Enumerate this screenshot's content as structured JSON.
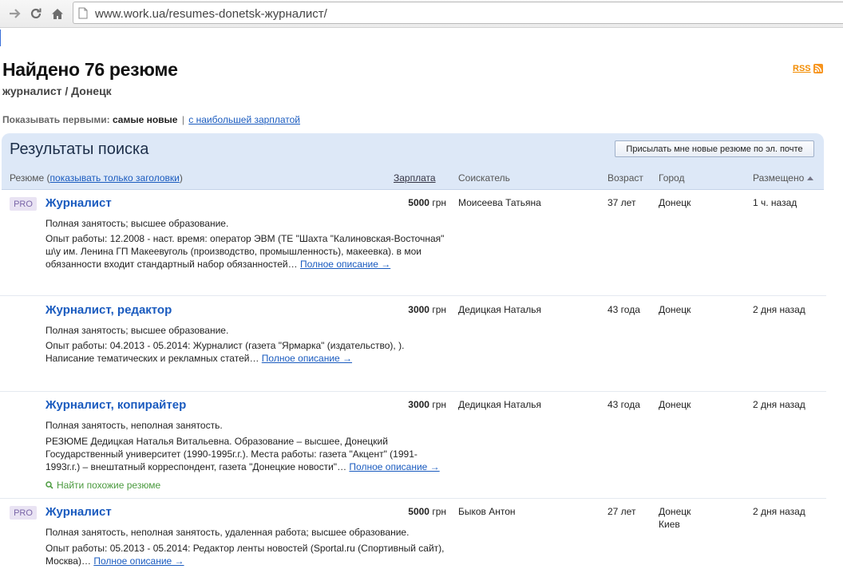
{
  "browser": {
    "url": "www.work.ua/resumes-donetsk-журналист/"
  },
  "page": {
    "title": "Найдено 76 резюме",
    "subtitle": "журналист / Донецк",
    "rss": "RSS",
    "sort": {
      "label": "Показывать первыми:",
      "active": "самые новые",
      "separator": "|",
      "alt": "с наибольшей зарплатой"
    }
  },
  "panel": {
    "title": "Результаты поиска",
    "subscribe_button": "Присылать мне новые резюме по эл. почте",
    "columns": {
      "resume_prefix": "Резюме (",
      "resume_link": "показывать только заголовки",
      "resume_suffix": ")",
      "salary": "Зарплата",
      "seeker": "Соискатель",
      "age": "Возраст",
      "city": "Город",
      "posted": "Размещено"
    }
  },
  "results": [
    {
      "pro": "PRO",
      "title": "Журналист",
      "salary_amount": "5000",
      "salary_currency": "грн",
      "name": "Моисеева Татьяна",
      "age": "37 лет",
      "city": "Донецк",
      "city2": "",
      "posted": "1 ч. назад",
      "employment": "Полная занятость; высшее образование.",
      "experience": "Опыт работы: 12.2008 - наст. время: оператор ЭВМ (ТЕ \"Шахта \"Калиновская-Восточная\" ш\\у им. Ленина ГП Макеевуголь (производство, промышленность), макеевка). в мои обязанности входит стандартный набор обязанностей…",
      "more": "Полное описание →",
      "similar": ""
    },
    {
      "pro": "",
      "title": "Журналист, редактор",
      "salary_amount": "3000",
      "salary_currency": "грн",
      "name": "Дедицкая Наталья",
      "age": "43 года",
      "city": "Донецк",
      "city2": "",
      "posted": "2 дня назад",
      "employment": "Полная занятость; высшее образование.",
      "experience": "Опыт работы: 04.2013 - 05.2014: Журналист (газета \"Ярмарка\" (издательство), ). Написание тематических и рекламных статей…",
      "more": "Полное описание →",
      "similar": ""
    },
    {
      "pro": "",
      "title": "Журналист, копирайтер",
      "salary_amount": "3000",
      "salary_currency": "грн",
      "name": "Дедицкая Наталья",
      "age": "43 года",
      "city": "Донецк",
      "city2": "",
      "posted": "2 дня назад",
      "employment": "Полная занятость, неполная занятость.",
      "experience": "РЕЗЮМЕ Дедицкая Наталья Витальевна. Образование – высшее, Донецкий Государственный университет (1990-1995г.г.). Места работы: газета \"Акцент\" (1991-1993г.г.) – внештатный корреспондент, газета \"Донецкие новости\"…",
      "more": "Полное описание →",
      "similar": "Найти похожие резюме"
    },
    {
      "pro": "PRO",
      "title": "Журналист",
      "salary_amount": "5000",
      "salary_currency": "грн",
      "name": "Быков Антон",
      "age": "27 лет",
      "city": "Донецк",
      "city2": "Киев",
      "posted": "2 дня назад",
      "employment": "Полная занятость, неполная занятость, удаленная работа; высшее образование.",
      "experience": "Опыт работы: 05.2013 - 05.2014: Редактор ленты новостей (Sportal.ru (Спортивный сайт), Москва)…",
      "more": "Полное описание →",
      "similar": ""
    }
  ]
}
